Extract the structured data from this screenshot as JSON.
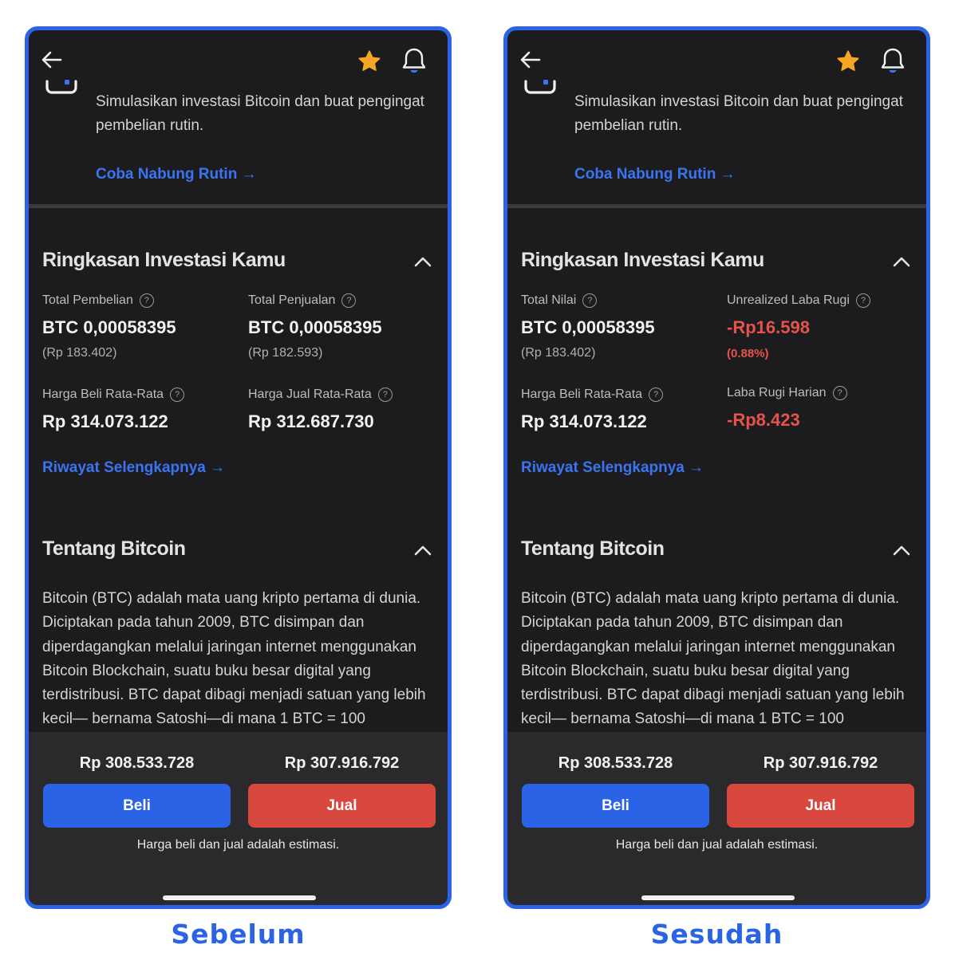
{
  "captions": {
    "before": "Sebelum",
    "after": "Sesudah"
  },
  "colors": {
    "accent": "#2b63e6",
    "sell": "#d9483f",
    "negative": "#e5534b",
    "star": "#f5a623",
    "background": "#1c1c1e"
  },
  "icons": {
    "back": "arrow-left-icon",
    "favorite": "star-icon",
    "notifications": "bell-icon",
    "expand": "chevron-up-icon",
    "help": "question-circle-icon"
  },
  "before": {
    "promo_text": "Simulasikan investasi Bitcoin dan buat pengingat pembelian rutin.",
    "promo_link": "Coba Nabung Rutin →",
    "summary": {
      "title": "Ringkasan Investasi Kamu",
      "stats": [
        {
          "label": "Total Pembelian",
          "value": "BTC 0,00058395",
          "sub": "(Rp 183.402)"
        },
        {
          "label": "Total Penjualan",
          "value": "BTC 0,00058395",
          "sub": "(Rp 182.593)"
        },
        {
          "label": "Harga Beli Rata-Rata",
          "value": "Rp 314.073.122"
        },
        {
          "label": "Harga Jual Rata-Rata",
          "value": "Rp 312.687.730"
        }
      ],
      "history_link": "Riwayat Selengkapnya →"
    },
    "about": {
      "title": "Tentang Bitcoin",
      "text": "Bitcoin (BTC) adalah mata uang kripto pertama di dunia. Diciptakan pada tahun 2009, BTC disimpan dan diperdagangkan melalui jaringan internet menggunakan Bitcoin Blockchain, suatu buku besar digital yang terdistribusi. BTC dapat dibagi menjadi satuan yang lebih kecil— bernama Satoshi—di mana 1 BTC = 100"
    },
    "trade": {
      "buy_price": "Rp 308.533.728",
      "sell_price": "Rp 307.916.792",
      "buy_label": "Beli",
      "sell_label": "Jual",
      "note": "Harga beli dan jual adalah estimasi."
    }
  },
  "after": {
    "promo_text": "Simulasikan investasi Bitcoin dan buat pengingat pembelian rutin.",
    "promo_link": "Coba Nabung Rutin →",
    "summary": {
      "title": "Ringkasan Investasi Kamu",
      "stats": [
        {
          "label": "Total Nilai",
          "value": "BTC 0,00058395",
          "sub": "(Rp 183.402)"
        },
        {
          "label": "Unrealized Laba Rugi",
          "value": "-Rp16.598",
          "sub": "(0.88%)"
        },
        {
          "label": "Harga Beli Rata-Rata",
          "value": "Rp 314.073.122"
        },
        {
          "label": "Laba Rugi Harian",
          "value": "-Rp8.423"
        }
      ],
      "history_link": "Riwayat Selengkapnya →"
    },
    "about": {
      "title": "Tentang Bitcoin",
      "text": "Bitcoin (BTC) adalah mata uang kripto pertama di dunia. Diciptakan pada tahun 2009, BTC disimpan dan diperdagangkan melalui jaringan internet menggunakan Bitcoin Blockchain, suatu buku besar digital yang terdistribusi. BTC dapat dibagi menjadi satuan yang lebih kecil— bernama Satoshi—di mana 1 BTC = 100"
    },
    "trade": {
      "buy_price": "Rp 308.533.728",
      "sell_price": "Rp 307.916.792",
      "buy_label": "Beli",
      "sell_label": "Jual",
      "note": "Harga beli dan jual adalah estimasi."
    }
  }
}
